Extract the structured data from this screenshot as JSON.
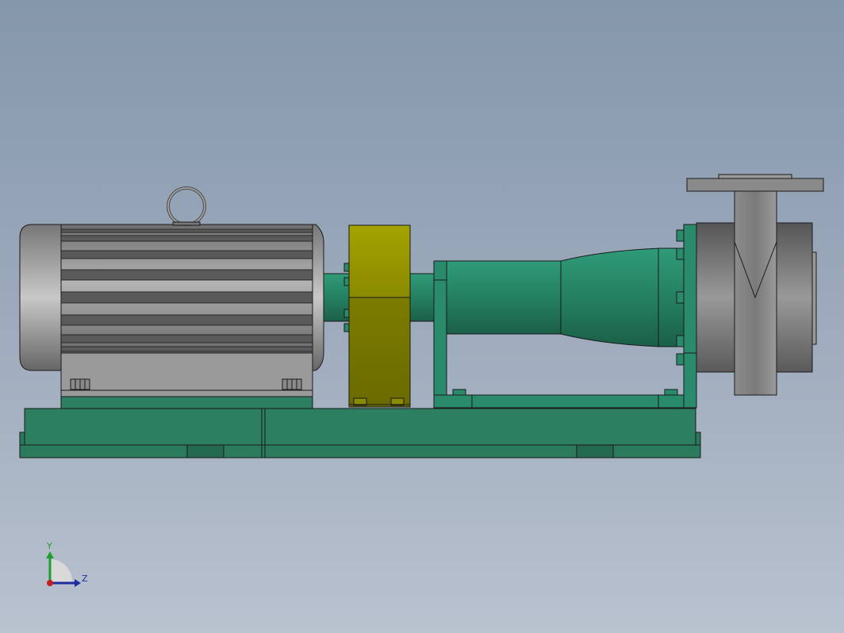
{
  "scene": {
    "subject": "pump-motor-assembly",
    "colors": {
      "background_top": "#8597ab",
      "background_bottom": "#b9c2cf",
      "baseplate_green": "#2a7a5c",
      "pump_teal": "#2a8a6c",
      "motor_gray": "#8a8a8a",
      "coupling_guard_yellow": "#9a9a00",
      "outline": "#1a1a1a"
    }
  },
  "triad": {
    "y_label": "Y",
    "z_label": "Z",
    "y_color": "#1e9e2e",
    "z_color": "#1e2e9e",
    "x_color": "#c41e1e"
  }
}
